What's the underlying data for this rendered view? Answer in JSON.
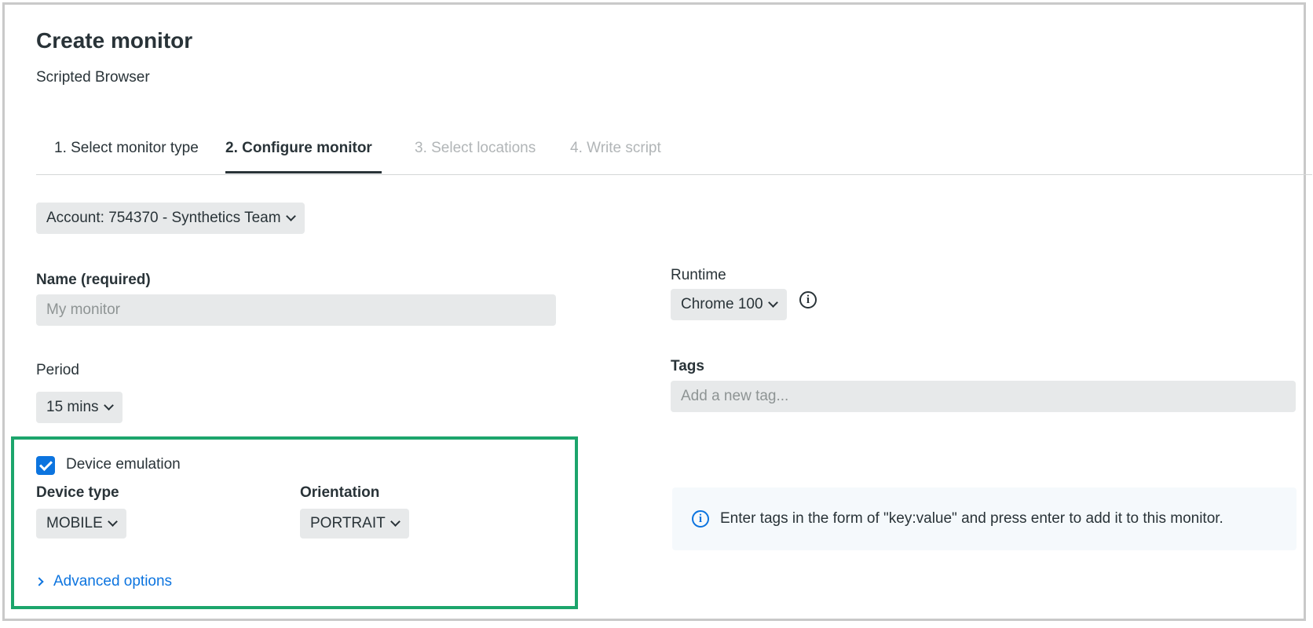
{
  "page": {
    "title": "Create monitor",
    "subtitle": "Scripted Browser"
  },
  "tabs": [
    {
      "label": "1. Select monitor type",
      "state": "complete"
    },
    {
      "label": "2. Configure monitor",
      "state": "active"
    },
    {
      "label": "3. Select locations",
      "state": "disabled"
    },
    {
      "label": "4. Write script",
      "state": "disabled"
    }
  ],
  "account": {
    "label": "Account: 754370 - Synthetics Team"
  },
  "name": {
    "label": "Name (required)",
    "placeholder": "My monitor",
    "value": ""
  },
  "period": {
    "label": "Period",
    "value": "15 mins"
  },
  "runtime": {
    "label": "Runtime",
    "value": "Chrome 100",
    "info_icon": "info-icon"
  },
  "tags": {
    "label": "Tags",
    "placeholder": "Add a new tag...",
    "help_text": "Enter tags in the form of \"key:value\" and press enter to add it to this monitor."
  },
  "device_emulation": {
    "label": "Device emulation",
    "checked": true,
    "device_type": {
      "label": "Device type",
      "value": "MOBILE"
    },
    "orientation": {
      "label": "Orientation",
      "value": "PORTRAIT"
    }
  },
  "advanced": {
    "label": "Advanced options"
  },
  "colors": {
    "accent": "#0c74df",
    "highlight": "#1ca56c",
    "text": "#293338",
    "field_bg": "#e7e9ea"
  }
}
